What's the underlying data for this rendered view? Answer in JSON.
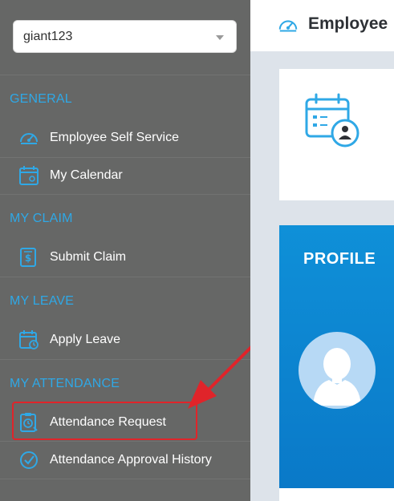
{
  "sidebar": {
    "company_select": {
      "value": "giant123"
    },
    "sections": [
      {
        "title": "GENERAL",
        "items": [
          {
            "label": "Employee Self Service",
            "icon": "speedometer-icon"
          },
          {
            "label": "My Calendar",
            "icon": "calendar-user-icon"
          }
        ]
      },
      {
        "title": "MY CLAIM",
        "items": [
          {
            "label": "Submit Claim",
            "icon": "claim-dollar-icon"
          }
        ]
      },
      {
        "title": "MY LEAVE",
        "items": [
          {
            "label": "Apply Leave",
            "icon": "calendar-clock-icon"
          }
        ]
      },
      {
        "title": "MY ATTENDANCE",
        "items": [
          {
            "label": "Attendance Request",
            "icon": "clipboard-clock-icon"
          },
          {
            "label": "Attendance Approval History",
            "icon": "check-circle-icon"
          }
        ]
      }
    ]
  },
  "header": {
    "title": "Employee",
    "icon": "speedometer-icon"
  },
  "main": {
    "card_icon": "calendar-user-icon",
    "profile": {
      "title": "PROFILE",
      "avatar": "user-silhouette-icon"
    }
  },
  "colors": {
    "sidebar_bg": "#666766",
    "section_title": "#2fa8e6",
    "icon_blue": "#2fa8e6",
    "highlight_red": "#e0242a",
    "profile_blue": "#0f90d8"
  }
}
